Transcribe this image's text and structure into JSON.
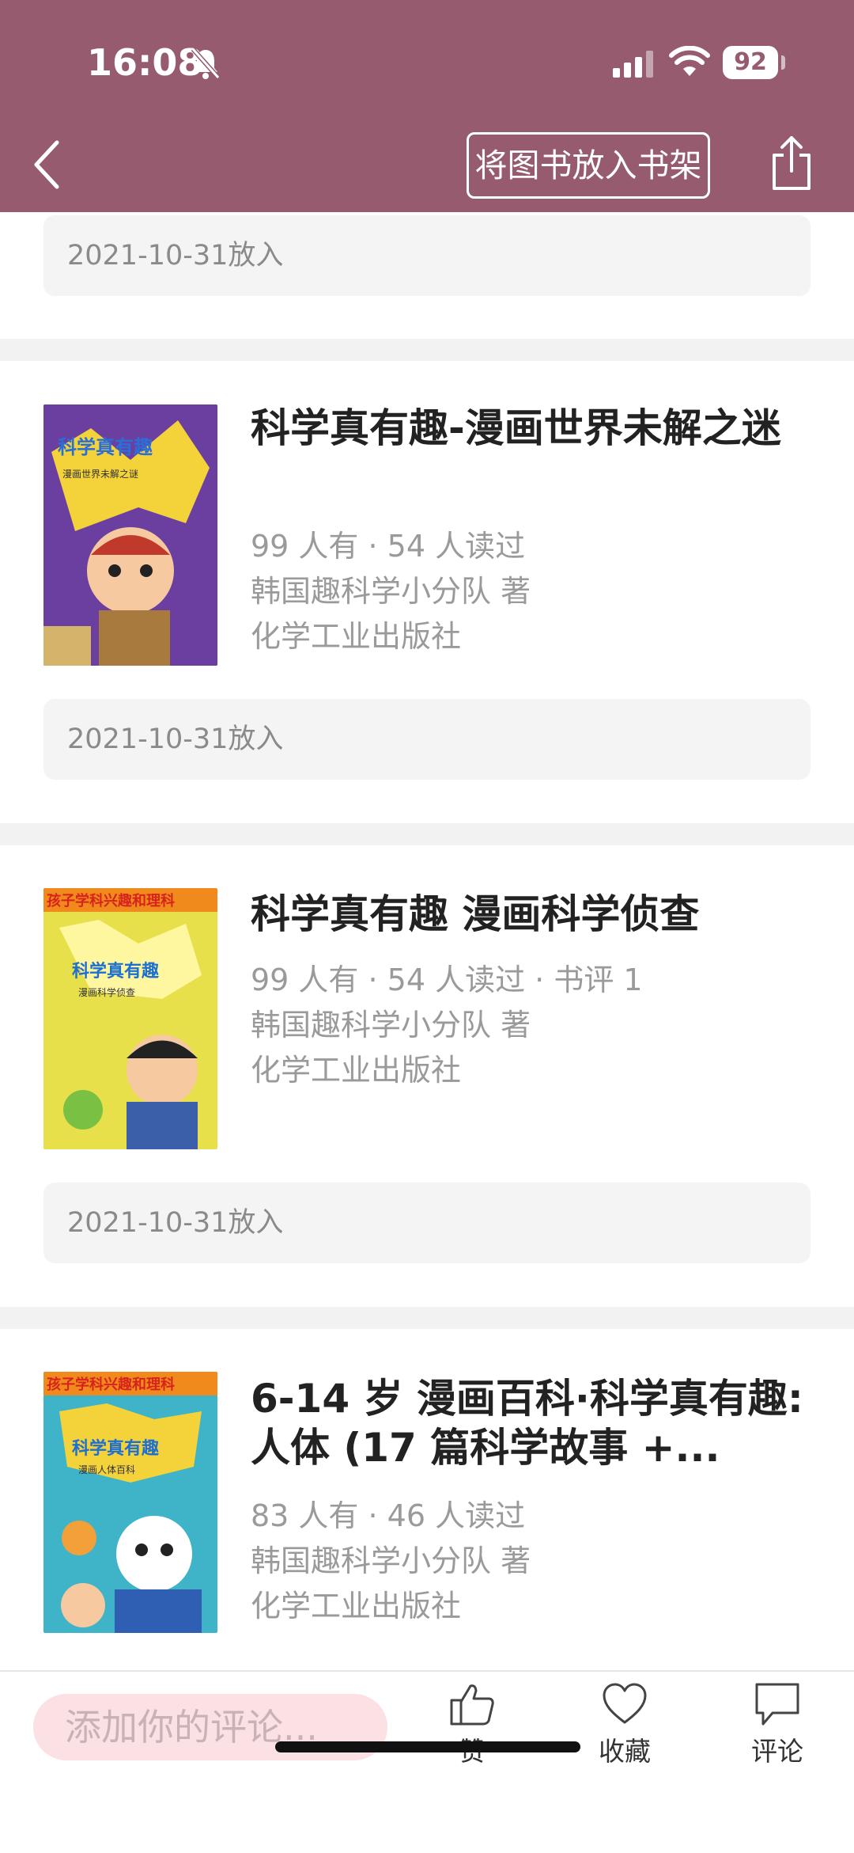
{
  "status_bar": {
    "time": "16:08",
    "battery": "92"
  },
  "header": {
    "shelf_button": "将图书放入书架"
  },
  "top_date": "2021-10-31放入",
  "books": [
    {
      "title": "科学真有趣-漫画世界未解之迷",
      "stats": "99 人有 · 54 人读过",
      "author": "韩国趣科学小分队 著",
      "publisher": "化学工业出版社",
      "date": "2021-10-31放入",
      "cover": {
        "title": "科学真有趣",
        "subtitle": "漫画世界未解之谜",
        "bg": "#6b3fa0"
      }
    },
    {
      "title": "科学真有趣 漫画科学侦查",
      "stats": "99 人有 · 54 人读过 · 书评 1",
      "author": "韩国趣科学小分队 著",
      "publisher": "化学工业出版社",
      "date": "2021-10-31放入",
      "cover": {
        "banner": "孩子学科兴趣和理科",
        "title": "科学真有趣",
        "subtitle": "漫画科学侦查",
        "bg": "#e8e04a"
      }
    },
    {
      "title": "6-14 岁 漫画百科·科学真有趣: 人体 (17 篇科学故事 +...",
      "stats": "83 人有 · 46 人读过",
      "author": "韩国趣科学小分队 著",
      "publisher": "化学工业出版社",
      "cover": {
        "banner": "孩子学科兴趣和理科",
        "title": "科学真有趣",
        "subtitle": "漫画人体百科",
        "bg": "#3fb3c8"
      }
    }
  ],
  "bottom_bar": {
    "comment_placeholder": "添加你的评论...",
    "like": "赞",
    "favorite": "收藏",
    "comment": "评论"
  },
  "colors": {
    "header": "#965b6e",
    "comment_bg": "#fbe0e4"
  }
}
